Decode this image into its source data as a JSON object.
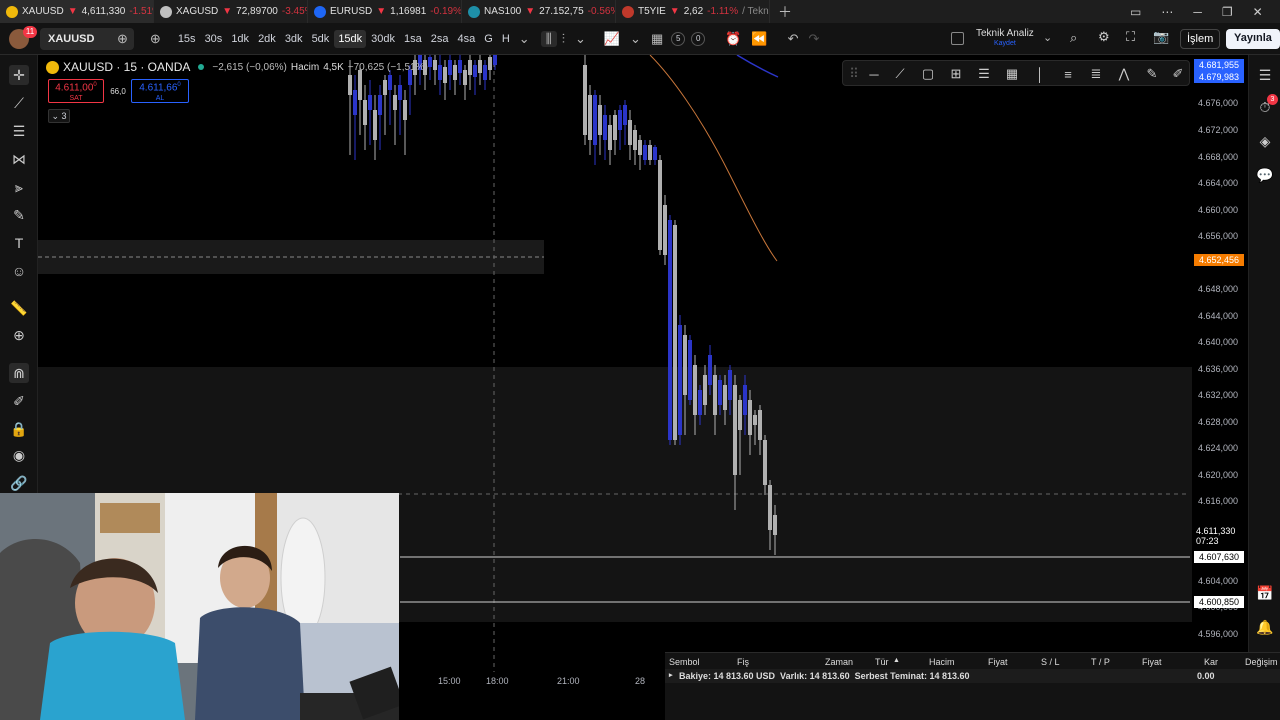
{
  "tabs": [
    {
      "symbol": "XAUUSD",
      "price": "4,611,330",
      "change": "-1.51%",
      "dot_color": "#f0b90b"
    },
    {
      "symbol": "XAGUSD",
      "price": "72,89700",
      "change": "-3.45%",
      "dot_color": "#bfbfbf"
    },
    {
      "symbol": "EURUSD",
      "price": "1,16981",
      "change": "-0.19%",
      "dot_color": "#1e66f5"
    },
    {
      "symbol": "NAS100",
      "price": "27.152,75",
      "change": "-0.56%",
      "dot_color": "#1e8fa8"
    },
    {
      "symbol": "T5YIE",
      "price": "2,62",
      "change": "-1.11%",
      "suffix": "/ Tekn",
      "dot_color": "#c0392b"
    }
  ],
  "toolbar": {
    "avatar_badge": "11",
    "symbol": "XAUUSD",
    "timeframes": [
      "15s",
      "30s",
      "1dk",
      "2dk",
      "3dk",
      "5dk",
      "15dk",
      "30dk",
      "1sa",
      "2sa",
      "4sa",
      "G",
      "H"
    ],
    "selected_timeframe": "15dk",
    "counters": [
      "5",
      "0"
    ],
    "analysis_title": "Teknik Analiz",
    "analysis_sub": "Kaydet",
    "trade_label": "İşlem",
    "publish_label": "Yayınla"
  },
  "legend": {
    "title": "XAUUSD · 15 · OANDA",
    "change": "−2,615 (−0,06%)",
    "volume_label": "Hacim",
    "volume": "4,5K",
    "volume_change": "−70,625 (−1,51%)",
    "sell_price": "4.611,00",
    "sell_sup": "0",
    "sell_label": "SAT",
    "spread": "66,0",
    "buy_price": "4.611,66",
    "buy_sup": "0",
    "buy_label": "AL",
    "indicator_count": "3"
  },
  "price_axis": {
    "labels": [
      "4.676,000",
      "4.672,000",
      "4.668,000",
      "4.664,000",
      "4.660,000",
      "4.656,000",
      "4.648,000",
      "4.644,000",
      "4.640,000",
      "4.636,000",
      "4.632,000",
      "4.628,000",
      "4.624,000",
      "4.620,000",
      "4.616,000",
      "4.604,000",
      "4.600,000",
      "4.596,000"
    ],
    "tag_top1": "4.681,955",
    "tag_top2": "4.679,983",
    "tag_orange": "4.652,456",
    "tag_current": "4.611,330",
    "tag_countdown": "07:23",
    "tag_line1": "4.607,630",
    "tag_line2": "4.600,850"
  },
  "time_axis": [
    "15:00",
    "18:00",
    "21:00",
    "28"
  ],
  "notification_badge": "3",
  "positions_table": {
    "headers": [
      "Sembol",
      "Fiş",
      "Zaman",
      "Tür",
      "Hacim",
      "Fiyat",
      "S / L",
      "T / P",
      "Fiyat",
      "Kar",
      "Değişim"
    ],
    "balance_line": "Bakiye: 14 813.60 USD  Varlık: 14 813.60  Serbest Teminat: 14 813.60",
    "profit": "0.00"
  },
  "colors": {
    "up_candle": "#2b35c9",
    "down_candle": "#b0b0b0",
    "sell": "#f23645",
    "buy": "#2962ff",
    "accent_orange": "#f57c00"
  }
}
